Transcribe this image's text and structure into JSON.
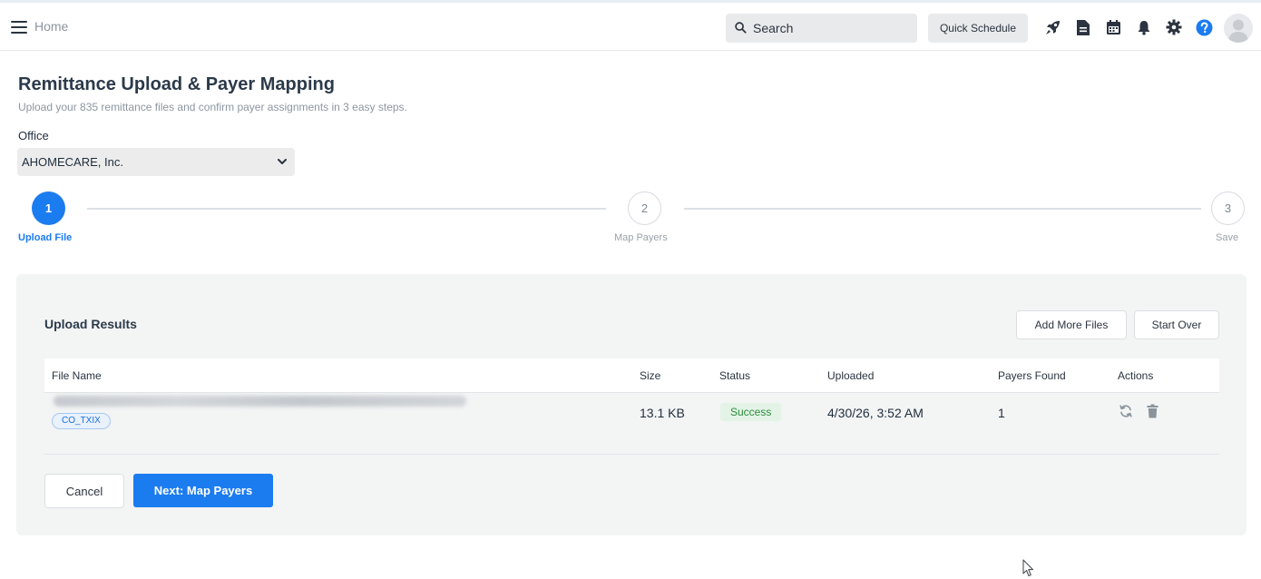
{
  "topbar": {
    "home_label": "Home",
    "search_placeholder": "Search",
    "quick_schedule_label": "Quick Schedule",
    "icons": [
      "menu-icon",
      "search-icon",
      "rocket-icon",
      "document-icon",
      "calendar-icon",
      "bell-icon",
      "gear-icon",
      "help-icon",
      "avatar"
    ]
  },
  "header": {
    "title": "Remittance Upload & Payer Mapping",
    "subtitle": "Upload your 835 remittance files and confirm payer assignments in 3 easy steps."
  },
  "office": {
    "label": "Office",
    "selected": "AHOMECARE, Inc."
  },
  "stepper": {
    "current_step": 1,
    "steps": [
      {
        "number": "1",
        "label": "Upload File"
      },
      {
        "number": "2",
        "label": "Map Payers"
      },
      {
        "number": "3",
        "label": "Save"
      }
    ]
  },
  "results": {
    "title": "Upload Results",
    "add_more_label": "Add More Files",
    "start_over_label": "Start Over",
    "columns": [
      "File Name",
      "Size",
      "Status",
      "Uploaded",
      "Payers Found",
      "Actions"
    ],
    "rows": [
      {
        "tag": "CO_TXIX",
        "size": "13.1 KB",
        "status": "Success",
        "uploaded": "4/30/26, 3:52 AM",
        "payers_found": "1"
      }
    ]
  },
  "footer": {
    "cancel_label": "Cancel",
    "next_label": "Next: Map Payers"
  },
  "colors": {
    "accent": "#1b7cf0",
    "success_bg": "#e3f4e6",
    "success_text": "#2c8a3e"
  }
}
